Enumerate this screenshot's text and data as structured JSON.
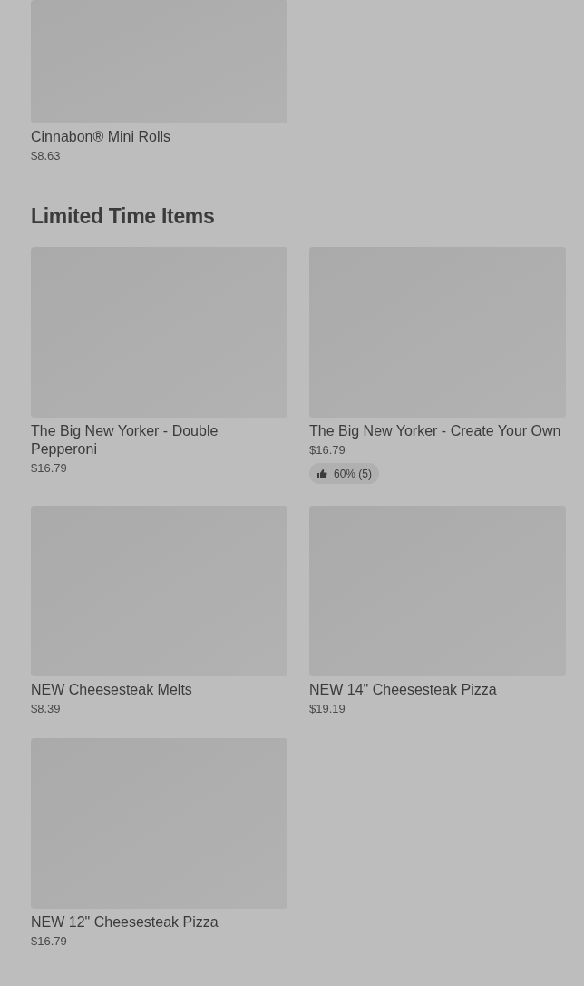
{
  "sections": [
    {
      "items": [
        {
          "name": "Cinnabon® Mini Rolls",
          "price": "$8.63"
        }
      ]
    },
    {
      "title": "Limited Time Items",
      "items": [
        {
          "name": "The Big New Yorker - Double Pepperoni",
          "price": "$16.79"
        },
        {
          "name": "The Big New Yorker - Create Your Own",
          "price": "$16.79",
          "rating": "60% (5)"
        },
        {
          "name": "NEW Cheesesteak Melts",
          "price": "$8.39"
        },
        {
          "name": "NEW 14\" Cheesesteak Pizza",
          "price": "$19.19"
        },
        {
          "name": "NEW 12\" Cheesesteak Pizza",
          "price": "$16.79"
        }
      ]
    }
  ]
}
